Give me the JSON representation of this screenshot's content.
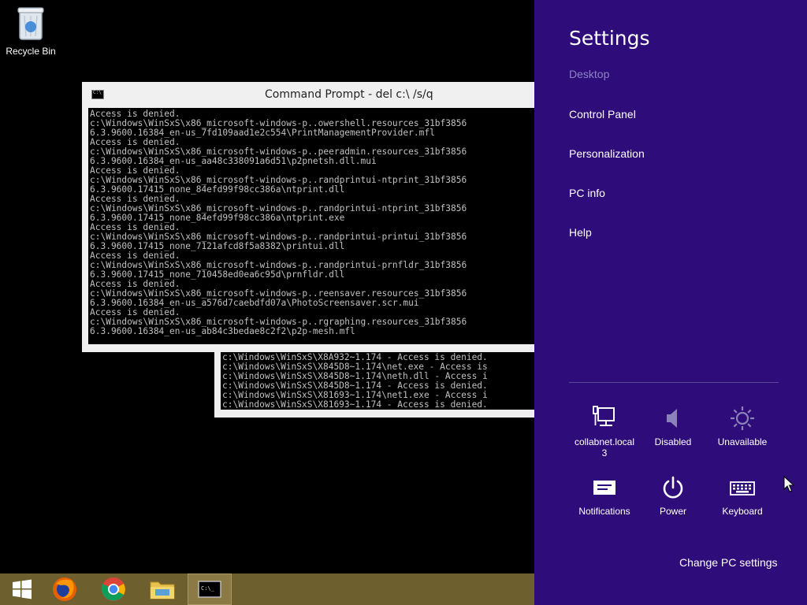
{
  "desktop": {
    "recycle_bin_label": "Recycle Bin"
  },
  "console_main": {
    "title": "Command Prompt - del  c:\\ /s/q",
    "lines": [
      "Access is denied.",
      "c:\\Windows\\WinSxS\\x86_microsoft-windows-p..owershell.resources_31bf3856",
      "6.3.9600.16384_en-us_7fd109aad1e2c554\\PrintManagementProvider.mfl",
      "Access is denied.",
      "c:\\Windows\\WinSxS\\x86_microsoft-windows-p..peeradmin.resources_31bf3856",
      "6.3.9600.16384_en-us_aa48c338091a6d51\\p2pnetsh.dll.mui",
      "Access is denied.",
      "c:\\Windows\\WinSxS\\x86_microsoft-windows-p..randprintui-ntprint_31bf3856",
      "6.3.9600.17415_none_84efd99f98cc386a\\ntprint.dll",
      "Access is denied.",
      "c:\\Windows\\WinSxS\\x86_microsoft-windows-p..randprintui-ntprint_31bf3856",
      "6.3.9600.17415_none_84efd99f98cc386a\\ntprint.exe",
      "Access is denied.",
      "c:\\Windows\\WinSxS\\x86_microsoft-windows-p..randprintui-printui_31bf3856",
      "6.3.9600.17415_none_7121afcd8f5a8382\\printui.dll",
      "Access is denied.",
      "c:\\Windows\\WinSxS\\x86_microsoft-windows-p..randprintui-prnfldr_31bf3856",
      "6.3.9600.17415_none_710458ed0ea6c95d\\prnfldr.dll",
      "Access is denied.",
      "c:\\Windows\\WinSxS\\x86_microsoft-windows-p..reensaver.resources_31bf3856",
      "6.3.9600.16384_en-us_a576d7caebdfd07a\\PhotoScreensaver.scr.mui",
      "Access is denied.",
      "c:\\Windows\\WinSxS\\x86_microsoft-windows-p..rgraphing.resources_31bf3856",
      "6.3.9600.16384_en-us_ab84c3bedae8c2f2\\p2p-mesh.mfl"
    ]
  },
  "console_back": {
    "lines": [
      "c:\\Windows\\WinSxS\\X8A932~1.174 - Access is denied.",
      "c:\\Windows\\WinSxS\\X845D8~1.174\\net.exe - Access is",
      "c:\\Windows\\WinSxS\\X845D8~1.174\\neth.dll - Access i",
      "c:\\Windows\\WinSxS\\X845D8~1.174 - Access is denied.",
      "c:\\Windows\\WinSxS\\X81693~1.174\\net1.exe - Access i",
      "c:\\Windows\\WinSxS\\X81693~1.174 - Access is denied."
    ]
  },
  "settings": {
    "title": "Settings",
    "context": "Desktop",
    "links": [
      "Control Panel",
      "Personalization",
      "PC info",
      "Help"
    ],
    "tiles": [
      {
        "label": "collabnet.local",
        "sub": "3"
      },
      {
        "label": "Disabled"
      },
      {
        "label": "Unavailable"
      },
      {
        "label": "Notifications"
      },
      {
        "label": "Power"
      },
      {
        "label": "Keyboard"
      }
    ],
    "change_pc_settings": "Change PC settings"
  },
  "colors": {
    "charm_bg": "#2e0d7a",
    "taskbar_bg": "#6e5f2f",
    "console_text": "#c0c0c0"
  }
}
